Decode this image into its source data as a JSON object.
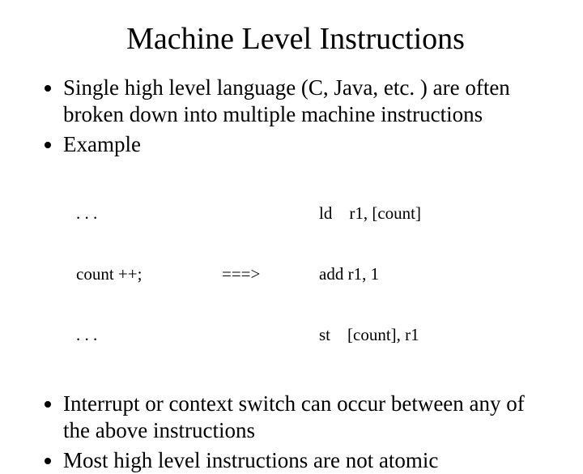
{
  "title": "Machine Level Instructions",
  "bullets": {
    "b1": "Single high level language (C, Java, etc. ) are often broken down into multiple machine instructions",
    "b2": "Example",
    "b3": "Interrupt or context switch can occur between any of the above instructions",
    "b4": "Most high level instructions are not atomic"
  },
  "example": {
    "src_l1": ". . .",
    "src_l2": "count ++;",
    "src_l3": ". . .",
    "arrow": "===>",
    "asm_l1": "ld    r1, [count]",
    "asm_l2": "add r1, 1",
    "asm_l3": "st    [count], r1"
  }
}
